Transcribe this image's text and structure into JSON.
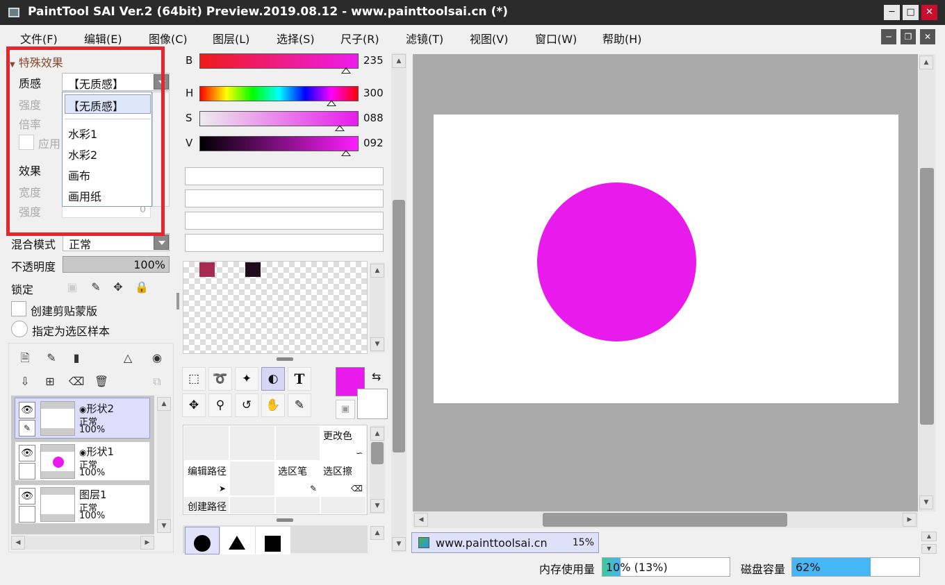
{
  "window": {
    "title": "PaintTool SAI Ver.2 (64bit) Preview.2019.08.12 - www.painttoolsai.cn (*)"
  },
  "menu": [
    "文件(F)",
    "编辑(E)",
    "图像(C)",
    "图层(L)",
    "选择(S)",
    "尺子(R)",
    "滤镜(T)",
    "视图(V)",
    "窗口(W)",
    "帮助(H)"
  ],
  "effects": {
    "section_title": "特殊效果",
    "texture_label": "质感",
    "texture_value": "【无质感】",
    "strength_label": "强度",
    "scale_label": "倍率",
    "apply_label": "应用",
    "effect_label": "效果",
    "width_label": "宽度",
    "strength2_label": "强度",
    "strength2_value": "0",
    "dropdown_options": [
      "【无质感】",
      "水彩1",
      "水彩2",
      "画布",
      "画用纸"
    ],
    "selected_option": "【无质感】"
  },
  "layer_props": {
    "blend_label": "混合模式",
    "blend_value": "正常",
    "opacity_label": "不透明度",
    "opacity_value": "100%",
    "lock_label": "锁定",
    "clip_label": "创建剪贴蒙版",
    "sample_label": "指定为选区样本"
  },
  "layers": [
    {
      "name": "形状2",
      "mode": "正常",
      "opacity": "100%",
      "selected": true
    },
    {
      "name": "形状1",
      "mode": "正常",
      "opacity": "100%",
      "selected": false
    },
    {
      "name": "图层1",
      "mode": "正常",
      "opacity": "100%",
      "selected": false
    }
  ],
  "color": {
    "b_label": "B",
    "b_value": "235",
    "h_label": "H",
    "h_value": "300",
    "s_label": "S",
    "s_value": "088",
    "v_label": "V",
    "v_value": "092",
    "b_level": 0.92,
    "h_level": 0.83,
    "s_level": 0.88,
    "v_level": 0.92,
    "main_color": "#e81bec",
    "swatches": [
      "#a72a52",
      "#200a1e"
    ]
  },
  "tools": {
    "text_tool_glyph": "T"
  },
  "brush_grid": {
    "change_color": "更改色",
    "edit_path": "编辑路径",
    "select_pen": "选区笔",
    "select_erase": "选区擦",
    "create_path": "创建路径"
  },
  "canvas": {
    "shape_color": "#e81bec"
  },
  "navigator": {
    "name": "www.painttoolsai.cn",
    "zoom": "15%"
  },
  "status": {
    "memory_label": "内存使用量",
    "memory_value": "10% (13%)",
    "memory_level": 0.1,
    "disk_label": "磁盘容量",
    "disk_value": "62%",
    "disk_level": 0.62
  }
}
